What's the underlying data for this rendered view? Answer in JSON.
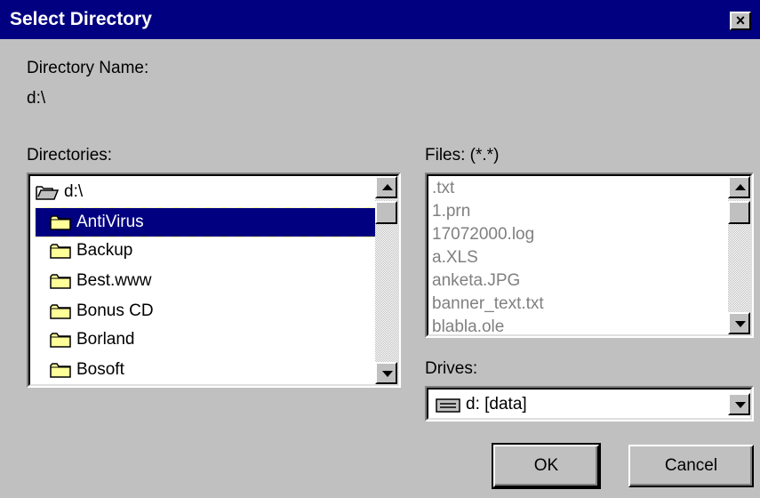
{
  "window": {
    "title": "Select Directory",
    "close_label": "×"
  },
  "directory_name": {
    "label": "Directory Name:",
    "value": "d:\\"
  },
  "directories": {
    "label": "Directories:",
    "root": "d:\\",
    "items": [
      {
        "label": "AntiVirus",
        "selected": true
      },
      {
        "label": "Backup"
      },
      {
        "label": "Best.www"
      },
      {
        "label": "Bonus CD"
      },
      {
        "label": "Borland"
      },
      {
        "label": "Bosoft"
      }
    ]
  },
  "files": {
    "label": "Files: (*.*)",
    "items": [
      ".txt",
      "1.prn",
      "17072000.log",
      "a.XLS",
      "anketa.JPG",
      "banner_text.txt",
      "blabla.ole"
    ]
  },
  "drives": {
    "label": "Drives:",
    "selected": "d: [data]"
  },
  "buttons": {
    "ok": "OK",
    "cancel": "Cancel"
  },
  "icons": {
    "folder": "folder-icon",
    "open_folder": "open-folder-icon",
    "drive": "drive-icon"
  },
  "colors": {
    "title_bar": "#000080",
    "selection": "#000080",
    "face": "#c0c0c0"
  }
}
